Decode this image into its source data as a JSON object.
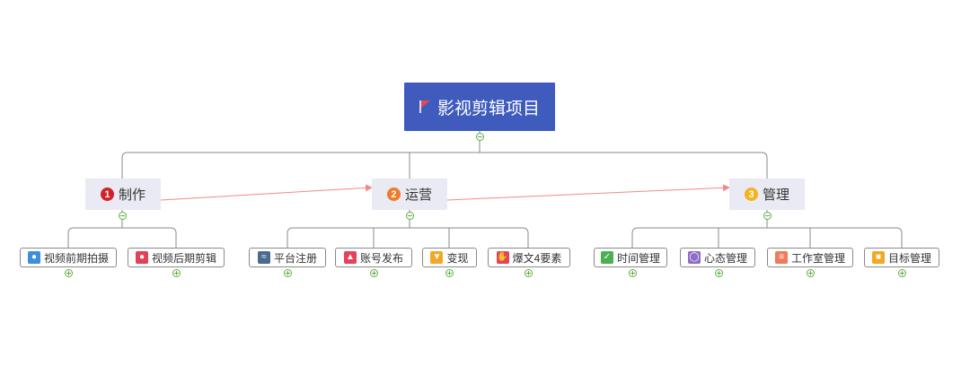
{
  "root": {
    "label": "影视剪辑项目",
    "icon": "red-flag-icon"
  },
  "branches": [
    {
      "number": "1",
      "label": "制作",
      "color": "#d0222a"
    },
    {
      "number": "2",
      "label": "运营",
      "color": "#ee7a2a"
    },
    {
      "number": "3",
      "label": "管理",
      "color": "#f5b21b"
    }
  ],
  "leaves": [
    {
      "label": "视频前期拍摄",
      "icon": "person-icon",
      "color": "#3b8fdc"
    },
    {
      "label": "视频后期剪辑",
      "icon": "person-icon",
      "color": "#e04257"
    },
    {
      "label": "平台注册",
      "icon": "handshake-icon",
      "color": "#4a6a92"
    },
    {
      "label": "账号发布",
      "icon": "fire-icon",
      "color": "#e6425a"
    },
    {
      "label": "变现",
      "icon": "trophy-icon",
      "color": "#f5a623"
    },
    {
      "label": "爆文4要素",
      "icon": "hand-icon",
      "color": "#e6425a"
    },
    {
      "label": "时间管理",
      "icon": "checkbox-icon",
      "color": "#4caf50"
    },
    {
      "label": "心态管理",
      "icon": "lightbulb-icon",
      "color": "#8e6dc8"
    },
    {
      "label": "工作室管理",
      "icon": "layers-icon",
      "color": "#f07a5a"
    },
    {
      "label": "目标管理",
      "icon": "folder-icon",
      "color": "#f5a623"
    }
  ],
  "colors": {
    "root_fill": "#3e5bbd",
    "branch_fill": "#e9eaf3",
    "relationship_arrow": "#f08a8a",
    "toggle": "#5fae44"
  }
}
